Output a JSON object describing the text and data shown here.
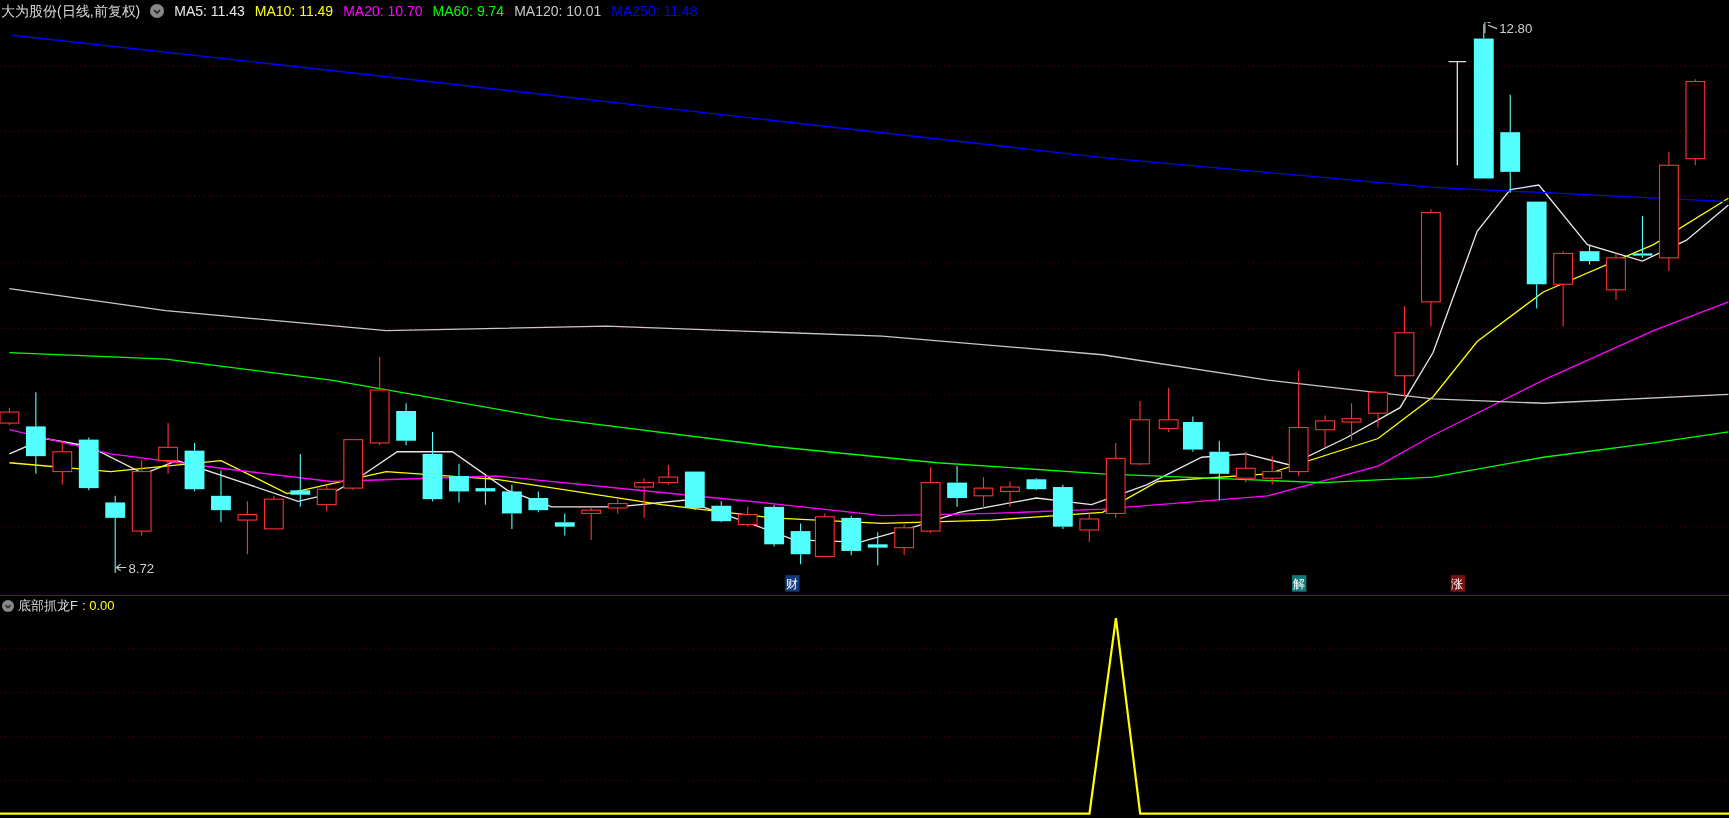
{
  "header": {
    "title": "大为股份(日线,前复权)",
    "indicators": [
      {
        "label": "MA5: 11.43",
        "color": "#e8e8e8"
      },
      {
        "label": "MA10: 11.49",
        "color": "#ffff00"
      },
      {
        "label": "MA20: 10.70",
        "color": "#ff00ff"
      },
      {
        "label": "MA60: 9.74",
        "color": "#00ff00"
      },
      {
        "label": "MA120: 10.01",
        "color": "#c8c8c8"
      },
      {
        "label": "MA250: 11.48",
        "color": "#0000ff"
      }
    ]
  },
  "chart": {
    "high_label": "12.80",
    "low_label": "8.72",
    "markers": [
      {
        "text": "财",
        "color": "#123a78"
      },
      {
        "text": "解",
        "color": "#127878"
      },
      {
        "text": "涨",
        "color": "#7a1010"
      }
    ]
  },
  "indicator_panel": {
    "title": "底部抓龙F",
    "value": ": 0.00"
  }
}
